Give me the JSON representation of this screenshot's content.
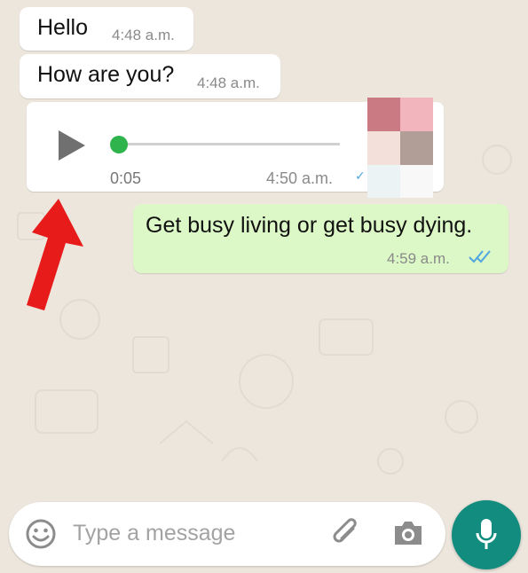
{
  "messages": [
    {
      "text": "Hello",
      "time": "4:48 a.m."
    },
    {
      "text": "How are you?",
      "time": "4:48 a.m."
    }
  ],
  "voice_note": {
    "duration": "0:05",
    "time": "4:50 a.m.",
    "progress": 0,
    "play_icon": "play-icon"
  },
  "outgoing": {
    "text": "Get busy living or get busy dying.",
    "time": "4:59 a.m.",
    "status_icon": "double-check-icon"
  },
  "composer": {
    "placeholder": "Type a message",
    "icons": [
      "emoji-icon",
      "attachment-icon",
      "camera-icon",
      "mic-icon"
    ]
  },
  "colors": {
    "wallpaper": "#ece6dd",
    "incoming_bubble": "#ffffff",
    "outgoing_bubble": "#dcf8c6",
    "accent": "#128c7e",
    "voice_dot": "#2fb34d",
    "read_ticks": "#4fa6e0",
    "arrow": "#e81b1b"
  }
}
